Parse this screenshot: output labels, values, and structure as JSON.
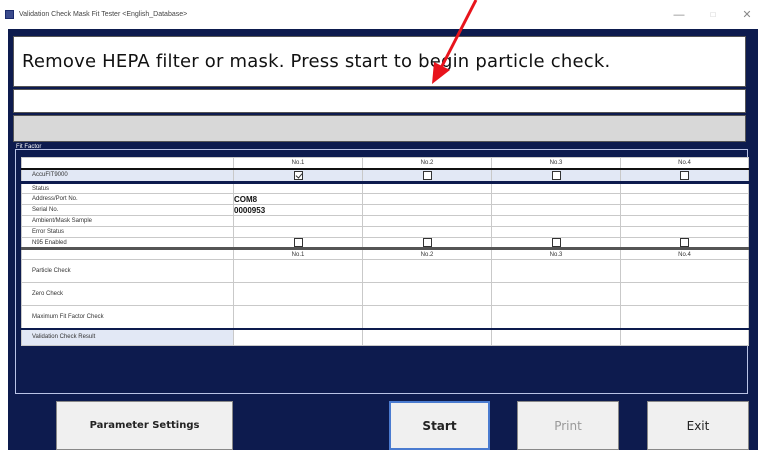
{
  "window": {
    "title": "Validation Check Mask Fit Tester <English_Database>",
    "minimize": "—",
    "maximize": "□",
    "close": "✕"
  },
  "message": {
    "main": "Remove HEPA filter or mask. Press start to begin particle check.",
    "secondary": "",
    "tertiary": ""
  },
  "fit_factor": {
    "section_label": "Fit Factor",
    "columns": [
      "No.1",
      "No.2",
      "No.3",
      "No.4"
    ],
    "accufit_row": {
      "label": "AccuFIT9000",
      "checked": [
        true,
        false,
        false,
        false
      ]
    },
    "status_rows": [
      {
        "label": "Status",
        "values": [
          "",
          "",
          "",
          ""
        ]
      },
      {
        "label": "Address/Port No.",
        "values": [
          "COM8",
          "",
          "",
          ""
        ]
      },
      {
        "label": "Serial No.",
        "values": [
          "0000953",
          "",
          "",
          ""
        ]
      },
      {
        "label": "Ambient/Mask Sample",
        "values": [
          "",
          "",
          "",
          ""
        ]
      },
      {
        "label": "Error Status",
        "values": [
          "",
          "",
          "",
          ""
        ]
      }
    ],
    "n95_row": {
      "label": "N95 Enabled",
      "checked": [
        false,
        false,
        false,
        false
      ]
    },
    "check_rows": [
      {
        "label": "Particle Check",
        "values": [
          "",
          "",
          "",
          ""
        ]
      },
      {
        "label": "Zero Check",
        "values": [
          "",
          "",
          "",
          ""
        ]
      },
      {
        "label": "Maximum Fit Factor Check",
        "values": [
          "",
          "",
          "",
          ""
        ]
      }
    ],
    "result_row": {
      "label": "Validation Check Result",
      "values": [
        "",
        "",
        "",
        ""
      ]
    }
  },
  "buttons": {
    "parameter_settings": "Parameter Settings",
    "start": "Start",
    "print": "Print",
    "exit": "Exit"
  },
  "colors": {
    "panel_background": "#0d1b4e",
    "annotation_arrow": "#e8141c"
  }
}
